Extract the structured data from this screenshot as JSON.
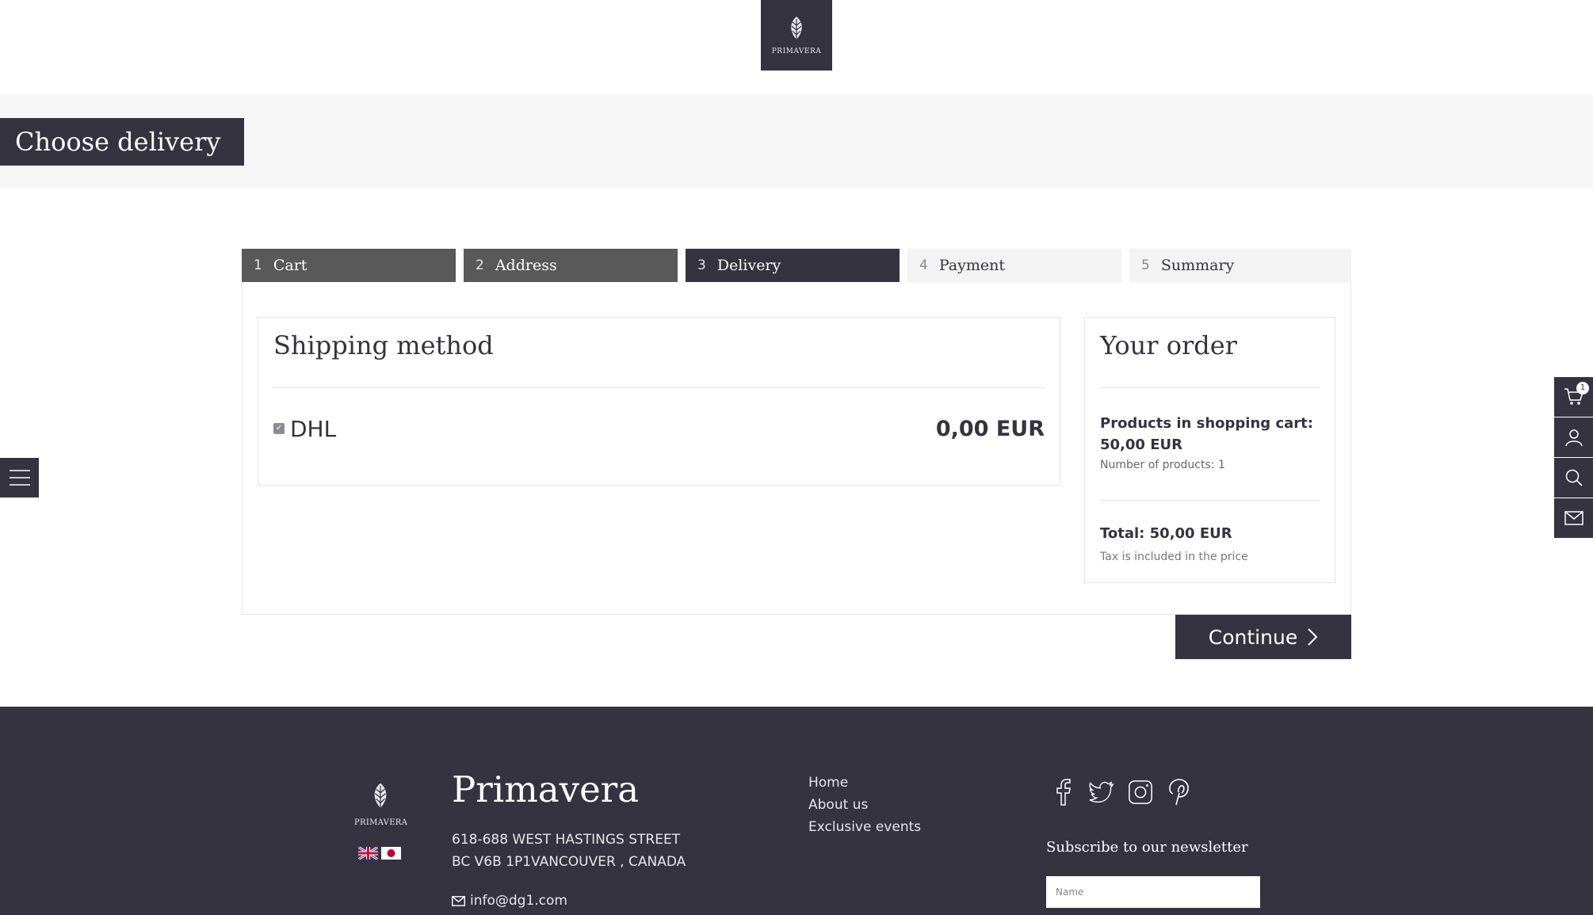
{
  "header": {
    "logo_text": "PRIMAVERA"
  },
  "page": {
    "title": "Choose delivery"
  },
  "steps": [
    {
      "num": "1",
      "label": "Cart",
      "state": "done"
    },
    {
      "num": "2",
      "label": "Address",
      "state": "done"
    },
    {
      "num": "3",
      "label": "Delivery",
      "state": "active"
    },
    {
      "num": "4",
      "label": "Payment",
      "state": "todo"
    },
    {
      "num": "5",
      "label": "Summary",
      "state": "todo"
    }
  ],
  "shipping": {
    "title": "Shipping method",
    "option": {
      "label": "DHL",
      "price": "0,00 EUR",
      "checked": true
    }
  },
  "order": {
    "title": "Your order",
    "products_label": "Products in shopping cart: 50,00 EUR",
    "count": "Number of products: 1",
    "total": "Total: 50,00 EUR",
    "tax": "Tax is included in the price"
  },
  "actions": {
    "continue_label": "Continue"
  },
  "tools": {
    "cart_count": "1"
  },
  "footer": {
    "logo_text": "PRIMAVERA",
    "brand": "Primavera",
    "address_line1": "618-688 WEST HASTINGS STREET",
    "address_line2": "BC V6B 1P1VANCOUVER , CANADA",
    "email": "info@dg1.com",
    "links": [
      "Home",
      "About us",
      "Exclusive events"
    ],
    "newsletter_title": "Subscribe to our newsletter",
    "newsletter_placeholder": "Name"
  },
  "colors": {
    "primary": "#34333f",
    "done_step": "#595959",
    "band": "#f6f6f6"
  }
}
